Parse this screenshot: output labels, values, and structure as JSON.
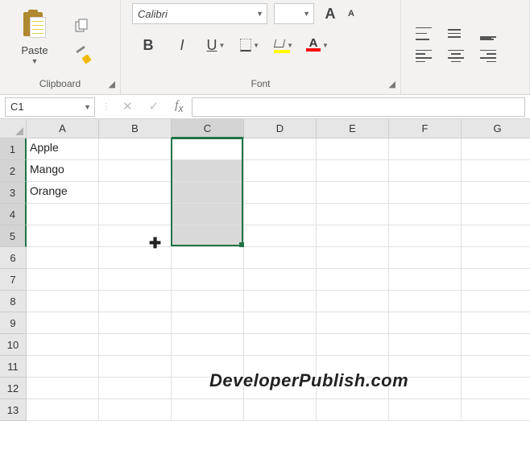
{
  "ribbon": {
    "clipboard": {
      "paste_label": "Paste",
      "group_label": "Clipboard"
    },
    "font": {
      "name": "Calibri",
      "size": "",
      "bold": "B",
      "italic": "I",
      "underline": "U",
      "group_label": "Font",
      "fontcolor_letter": "A",
      "grow_big": "A",
      "grow_small": "A"
    }
  },
  "namebox": {
    "ref": "C1"
  },
  "columns": [
    "A",
    "B",
    "C",
    "D",
    "E",
    "F",
    "G"
  ],
  "rows": [
    "1",
    "2",
    "3",
    "4",
    "5",
    "6",
    "7",
    "8",
    "9",
    "10",
    "11",
    "12",
    "13"
  ],
  "cells": {
    "A1": "Apple",
    "A2": "Mango",
    "A3": "Orange"
  },
  "selection": {
    "active": "C1",
    "range": "C1:C5"
  },
  "watermark": "DeveloperPublish.com"
}
